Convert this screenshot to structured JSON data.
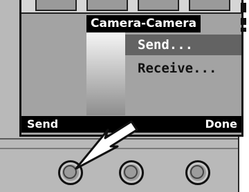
{
  "menu": {
    "title": "Camera-Camera",
    "items": [
      {
        "label": "Send...",
        "selected": true
      },
      {
        "label": "Receive...",
        "selected": false
      }
    ]
  },
  "softkeys": {
    "left": "Send",
    "right": "Done"
  },
  "icons": {
    "pointer": "pointer-arrow-icon",
    "buttons": [
      "round-button-icon",
      "round-button-icon",
      "round-button-icon"
    ]
  },
  "colors": {
    "screen_bg": "#a3a3a3",
    "selection": "#636363",
    "softkey_bar": "#000000"
  }
}
